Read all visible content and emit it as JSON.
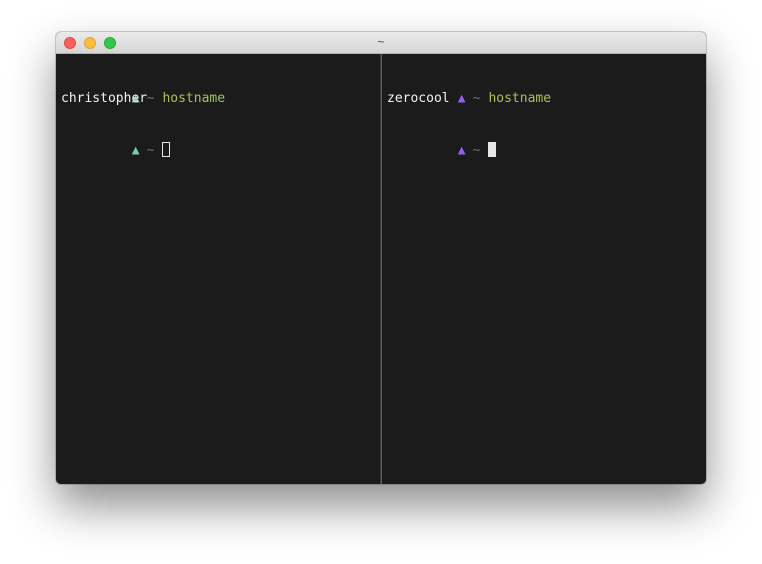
{
  "window": {
    "title": "~"
  },
  "colors": {
    "left_prompt_triangle": "#7ec8b0",
    "right_prompt_triangle": "#9a5cf0",
    "command": "#a6c25c",
    "tilde": "#707070",
    "output": "#f2f2f2",
    "background": "#1b1b1b"
  },
  "panes": [
    {
      "prompt_symbol": "▲",
      "cwd": "~",
      "command": "hostname",
      "output": "christopher",
      "next_prompt_symbol": "▲",
      "next_cwd": "~",
      "cursor_style": "outline"
    },
    {
      "prompt_symbol": "▲",
      "cwd": "~",
      "command": "hostname",
      "output": "zerocool",
      "next_prompt_symbol": "▲",
      "next_cwd": "~",
      "cursor_style": "solid"
    }
  ]
}
